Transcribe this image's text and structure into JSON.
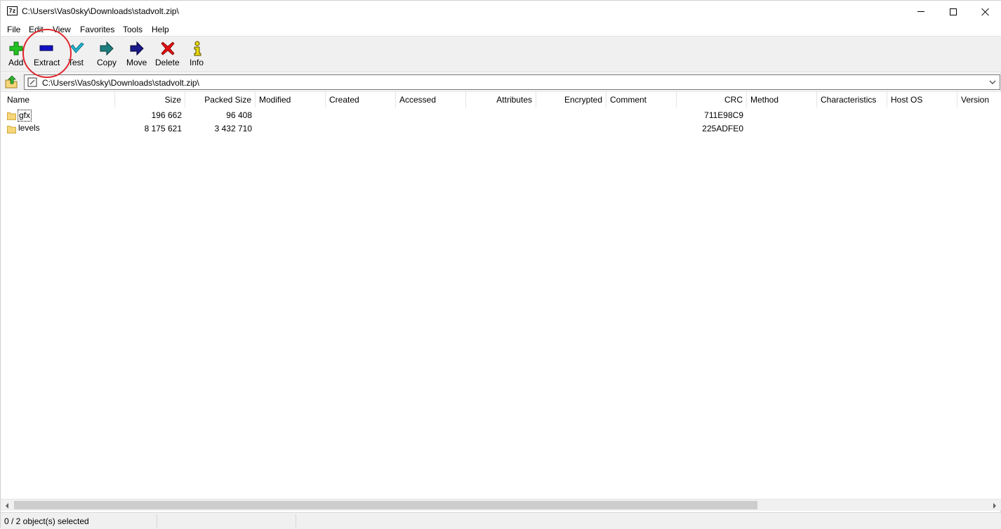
{
  "window": {
    "title": "C:\\Users\\Vas0sky\\Downloads\\stadvolt.zip\\",
    "app_icon_text": "7z"
  },
  "menu": [
    "File",
    "Edit",
    "View",
    "Favorites",
    "Tools",
    "Help"
  ],
  "toolbar": [
    {
      "label": "Add",
      "icon": "add-icon",
      "color": "#22c322"
    },
    {
      "label": "Extract",
      "icon": "extract-icon",
      "color": "#1010c8"
    },
    {
      "label": "Test",
      "icon": "test-icon",
      "color": "#22b8d8"
    },
    {
      "label": "Copy",
      "icon": "copy-icon",
      "color": "#1e7e7e"
    },
    {
      "label": "Move",
      "icon": "move-icon",
      "color": "#1a1a8a"
    },
    {
      "label": "Delete",
      "icon": "delete-icon",
      "color": "#e01010"
    },
    {
      "label": "Info",
      "icon": "info-icon",
      "color": "#e8d800"
    }
  ],
  "address": {
    "path": "C:\\Users\\Vas0sky\\Downloads\\stadvolt.zip\\"
  },
  "columns": [
    "Name",
    "Size",
    "Packed Size",
    "Modified",
    "Created",
    "Accessed",
    "Attributes",
    "Encrypted",
    "Comment",
    "CRC",
    "Method",
    "Characteristics",
    "Host OS",
    "Version"
  ],
  "rows": [
    {
      "name": "gfx",
      "size": "196 662",
      "packed": "96 408",
      "crc": "711E98C9"
    },
    {
      "name": "levels",
      "size": "8 175 621",
      "packed": "3 432 710",
      "crc": "225ADFE0"
    }
  ],
  "status": {
    "selection": "0 / 2 object(s) selected"
  },
  "colors": {
    "annotation": "#e0262c",
    "folder": "#f5d67a"
  }
}
